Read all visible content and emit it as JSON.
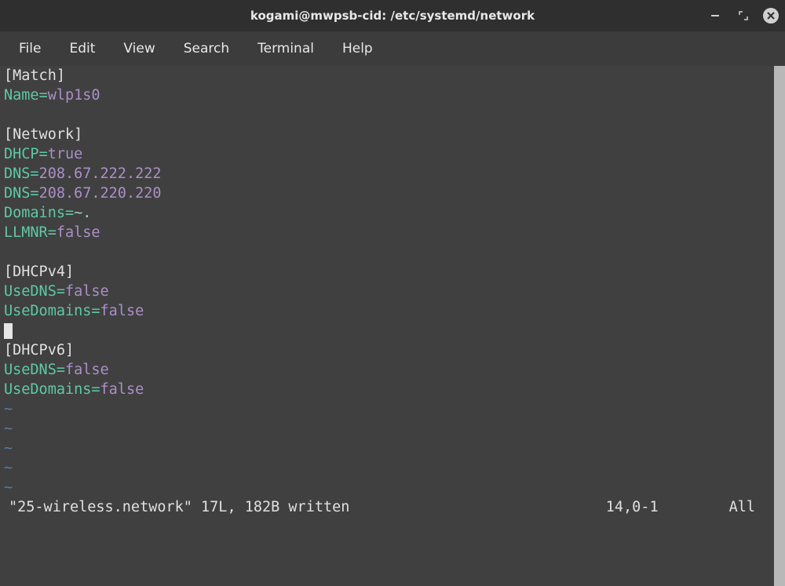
{
  "window": {
    "title": "kogami@mwpsb-cid: /etc/systemd/network"
  },
  "menu": {
    "file": "File",
    "edit": "Edit",
    "view": "View",
    "search": "Search",
    "terminal": "Terminal",
    "help": "Help"
  },
  "editor": {
    "sections": [
      {
        "header": "[Match]",
        "entries": [
          {
            "key": "Name",
            "value": "wlp1s0",
            "valClass": "valp"
          }
        ]
      },
      {
        "header": "[Network]",
        "entries": [
          {
            "key": "DHCP",
            "value": "true",
            "valClass": "valp"
          },
          {
            "key": "DNS",
            "value": "208.67.222.222",
            "valClass": "vald"
          },
          {
            "key": "DNS",
            "value": "208.67.220.220",
            "valClass": "vald"
          },
          {
            "key": "Domains",
            "value": "~.",
            "valClass": "vtil"
          },
          {
            "key": "LLMNR",
            "value": "false",
            "valClass": "valp"
          }
        ]
      },
      {
        "header": "[DHCPv4]",
        "entries": [
          {
            "key": "UseDNS",
            "value": "false",
            "valClass": "valp"
          },
          {
            "key": "UseDomains",
            "value": "false",
            "valClass": "valp"
          }
        ]
      },
      {
        "header": "[DHCPv6]",
        "entries": [
          {
            "key": "UseDNS",
            "value": "false",
            "valClass": "valp"
          },
          {
            "key": "UseDomains",
            "value": "false",
            "valClass": "valp"
          }
        ]
      }
    ],
    "cursor_after_section_index": 2,
    "tilde_count": 5
  },
  "status": {
    "left": "\"25-wireless.network\" 17L, 182B written",
    "position": "14,0-1",
    "scroll": "All"
  }
}
